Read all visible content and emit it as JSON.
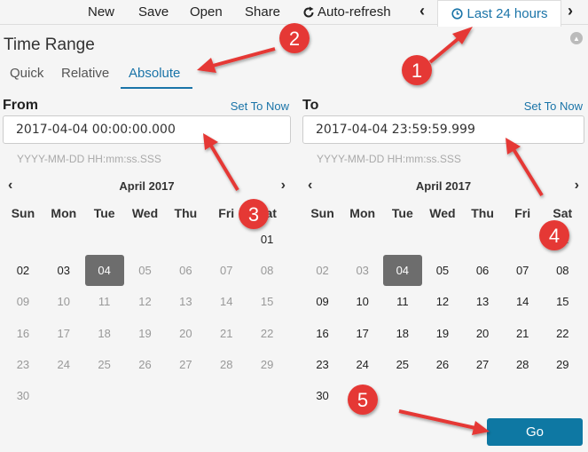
{
  "toolbar": {
    "new_label": "New",
    "save_label": "Save",
    "open_label": "Open",
    "share_label": "Share",
    "autorefresh_label": "Auto-refresh",
    "time_range_label": "Last 24 hours",
    "prev_icon": "chevron-left-icon",
    "next_icon": "chevron-right-icon"
  },
  "panel": {
    "title": "Time Range",
    "tabs": [
      "Quick",
      "Relative",
      "Absolute"
    ],
    "active_tab": "Absolute"
  },
  "from": {
    "label": "From",
    "set_now": "Set To Now",
    "value": "2017-04-04 00:00:00.000",
    "format_hint": "YYYY-MM-DD HH:mm:ss.SSS",
    "month": "April 2017",
    "selected_day": "04"
  },
  "to": {
    "label": "To",
    "set_now": "Set To Now",
    "value": "2017-04-04 23:59:59.999",
    "format_hint": "YYYY-MM-DD HH:mm:ss.SSS",
    "month": "April 2017",
    "selected_day": "04"
  },
  "weekdays": [
    "Sun",
    "Mon",
    "Tue",
    "Wed",
    "Thu",
    "Fri",
    "Sat"
  ],
  "calendar_weeks": [
    [
      "",
      "",
      "",
      "",
      "",
      "",
      "01"
    ],
    [
      "02",
      "03",
      "04",
      "05",
      "06",
      "07",
      "08"
    ],
    [
      "09",
      "10",
      "11",
      "12",
      "13",
      "14",
      "15"
    ],
    [
      "16",
      "17",
      "18",
      "19",
      "20",
      "21",
      "22"
    ],
    [
      "23",
      "24",
      "25",
      "26",
      "27",
      "28",
      "29"
    ],
    [
      "30",
      "",
      "",
      "",
      "",
      "",
      ""
    ]
  ],
  "go_label": "Go",
  "annotations": [
    "1",
    "2",
    "3",
    "4",
    "5"
  ],
  "colors": {
    "accent": "#1a74a8",
    "button": "#0e78a3",
    "selected_day": "#6d6d6d",
    "annotation": "#e53935"
  }
}
